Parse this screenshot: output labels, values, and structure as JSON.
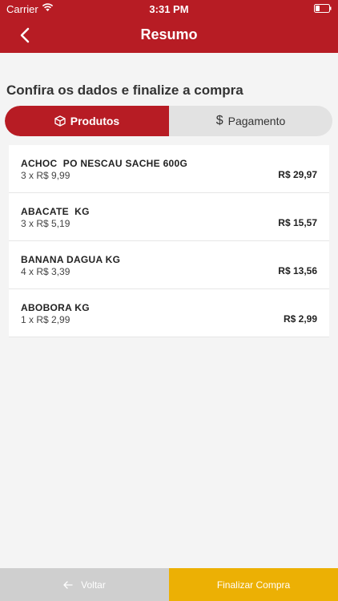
{
  "status_bar": {
    "carrier": "Carrier",
    "time": "3:31 PM"
  },
  "header": {
    "title": "Resumo"
  },
  "subtitle": "Confira os dados e finalize a compra",
  "tabs": [
    {
      "label": "Produtos",
      "icon": "box-icon",
      "active": true
    },
    {
      "label": "Pagamento",
      "icon": "dollar-icon",
      "active": false
    }
  ],
  "products": [
    {
      "name": "ACHOC  PO NESCAU SACHE 600G",
      "qty": "3 x R$ 9,99",
      "total": "R$ 29,97"
    },
    {
      "name": "ABACATE  KG",
      "qty": "3 x R$ 5,19",
      "total": "R$ 15,57"
    },
    {
      "name": "BANANA DAGUA KG",
      "qty": "4 x R$ 3,39",
      "total": "R$ 13,56"
    },
    {
      "name": "ABOBORA KG",
      "qty": "1 x R$ 2,99",
      "total": "R$ 2,99"
    }
  ],
  "footer": {
    "back_label": "Voltar",
    "finish_label": "Finalizar Compra"
  },
  "colors": {
    "brand": "#b71c24",
    "accent": "#ecb004",
    "disabled": "#cfcfcf"
  }
}
